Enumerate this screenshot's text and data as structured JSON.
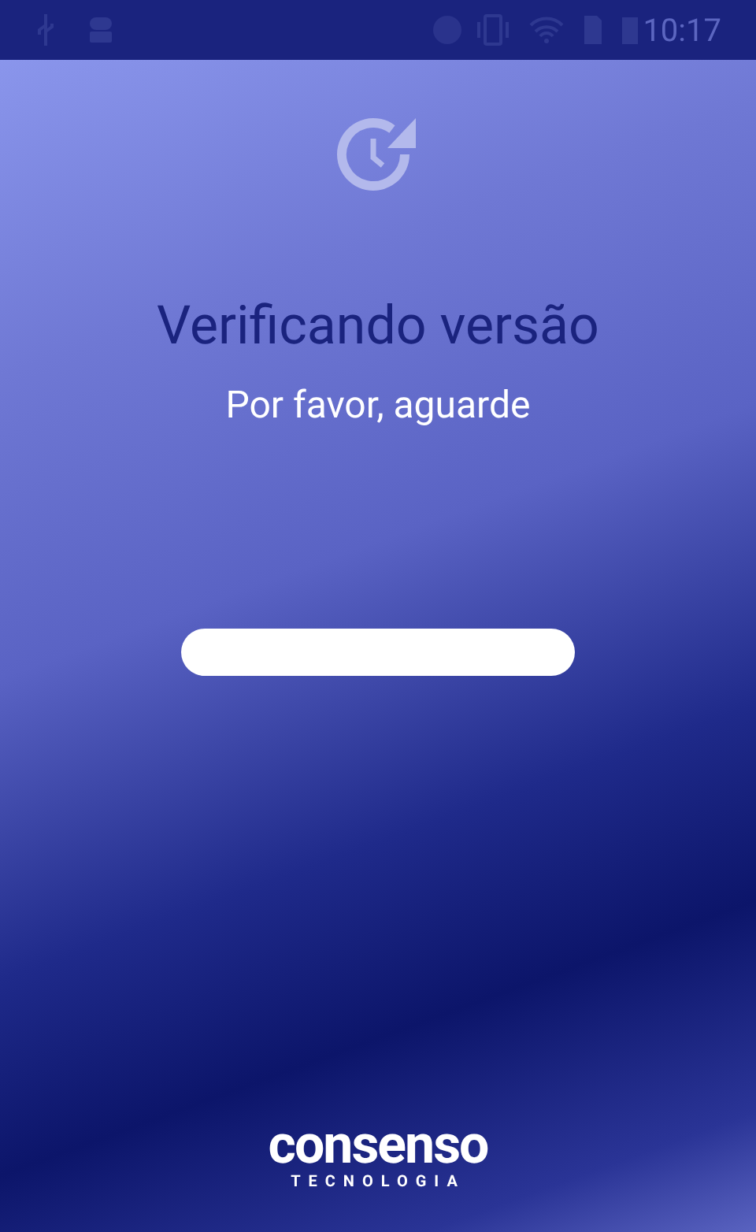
{
  "status_bar": {
    "time": "10:17"
  },
  "title": "Verificando versão",
  "subtitle": "Por favor, aguarde",
  "logo": {
    "name": "consenso",
    "tagline": "TECNOLOGIA"
  }
}
